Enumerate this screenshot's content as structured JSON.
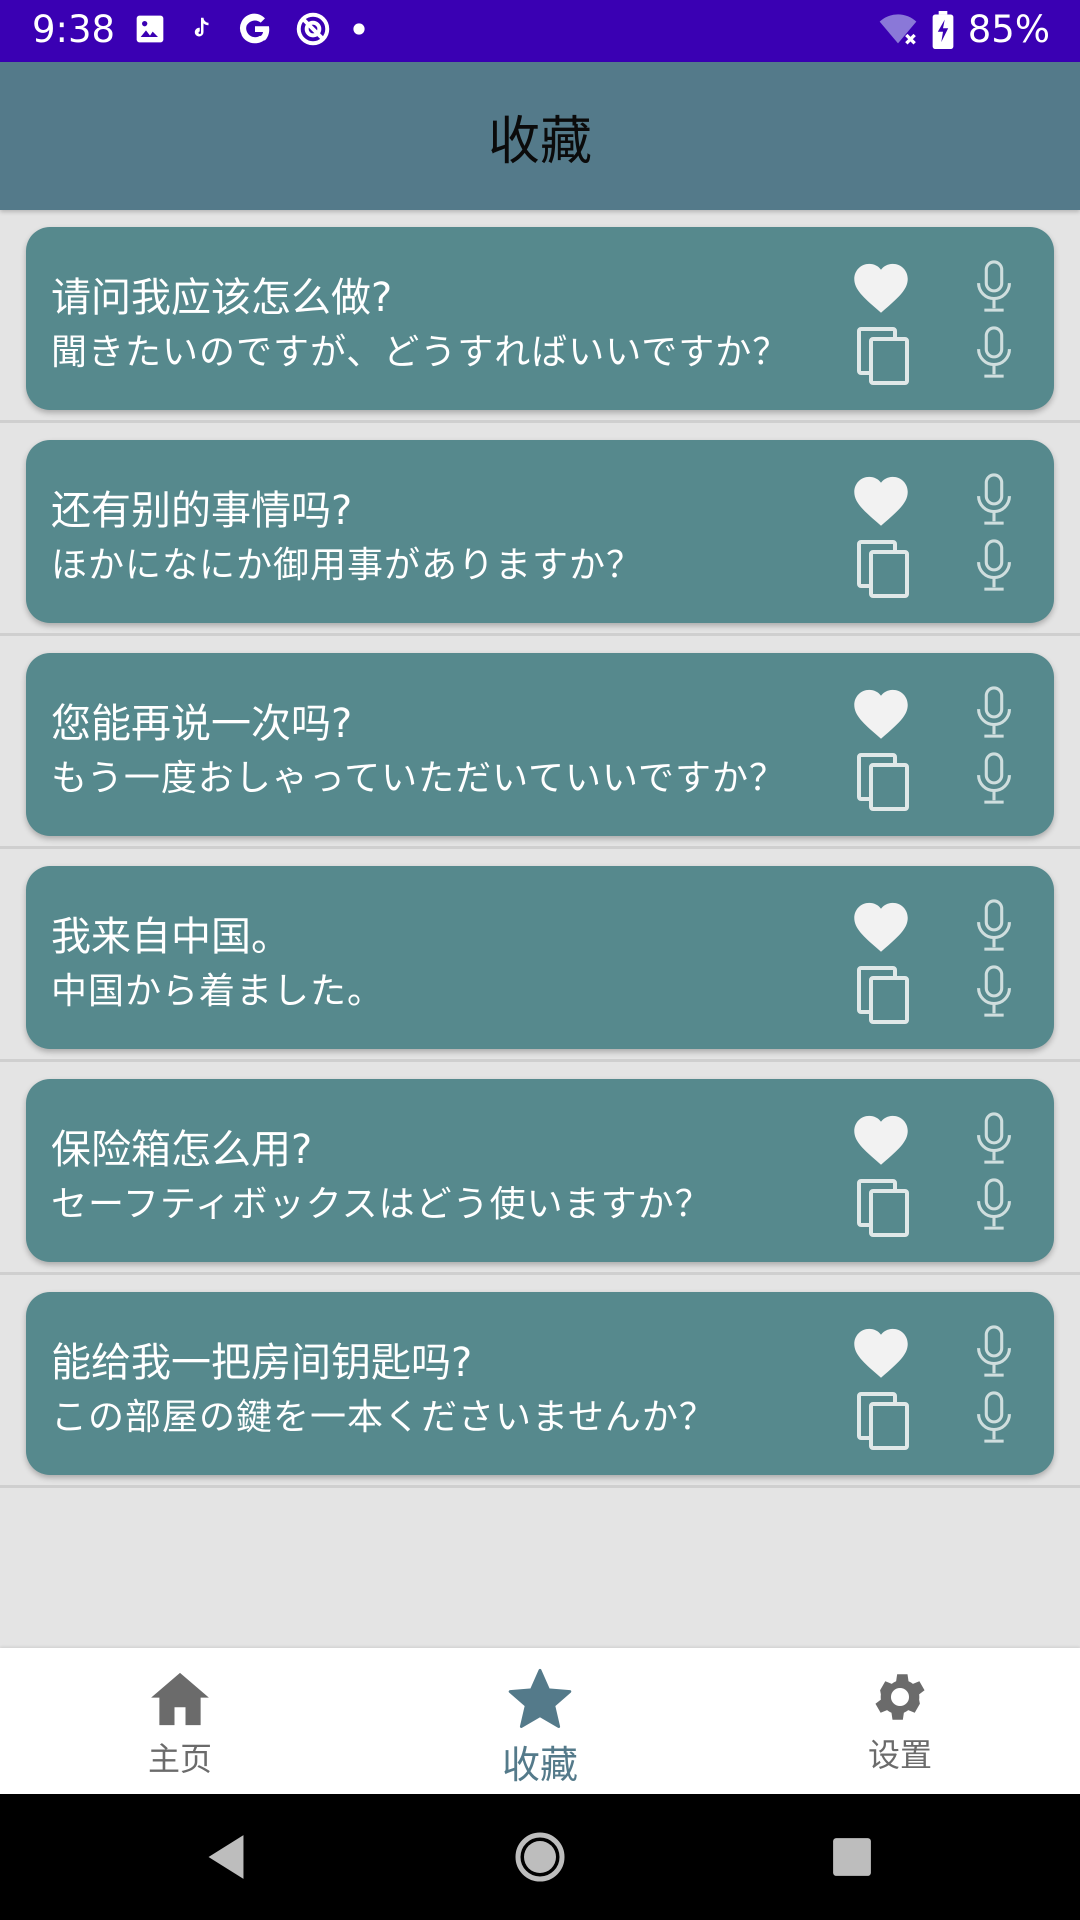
{
  "status_bar": {
    "time": "9:38",
    "battery": "85%",
    "icons": [
      "image-icon",
      "tiktok-icon",
      "google-icon",
      "app-icon",
      "dot-icon",
      "wifi-off-icon",
      "battery-charging-icon"
    ]
  },
  "app_bar": {
    "title": "收藏"
  },
  "phrases": [
    {
      "zh": "请问我应该怎么做?",
      "ja": "聞きたいのですが、どうすればいいですか？"
    },
    {
      "zh": "还有别的事情吗?",
      "ja": "ほかになにか御用事がありますか？"
    },
    {
      "zh": "您能再说一次吗?",
      "ja": "もう一度おしゃっていただいていいですか？"
    },
    {
      "zh": "我来自中国。",
      "ja": "中国から着ました。"
    },
    {
      "zh": "保险箱怎么用?",
      "ja": "セーフティボックスはどう使いますか？"
    },
    {
      "zh": "能给我一把房间钥匙吗?",
      "ja": "この部屋の鍵を一本くださいませんか？"
    }
  ],
  "bottom_nav": {
    "home": "主页",
    "favorites": "收藏",
    "settings": "设置"
  },
  "colors": {
    "status_bar": "#3a00b3",
    "app_bar": "#547a8a",
    "card": "#56898d",
    "background": "#e4e4e4",
    "nav_active": "#547a8a",
    "nav_inactive": "#6b6b6b"
  }
}
